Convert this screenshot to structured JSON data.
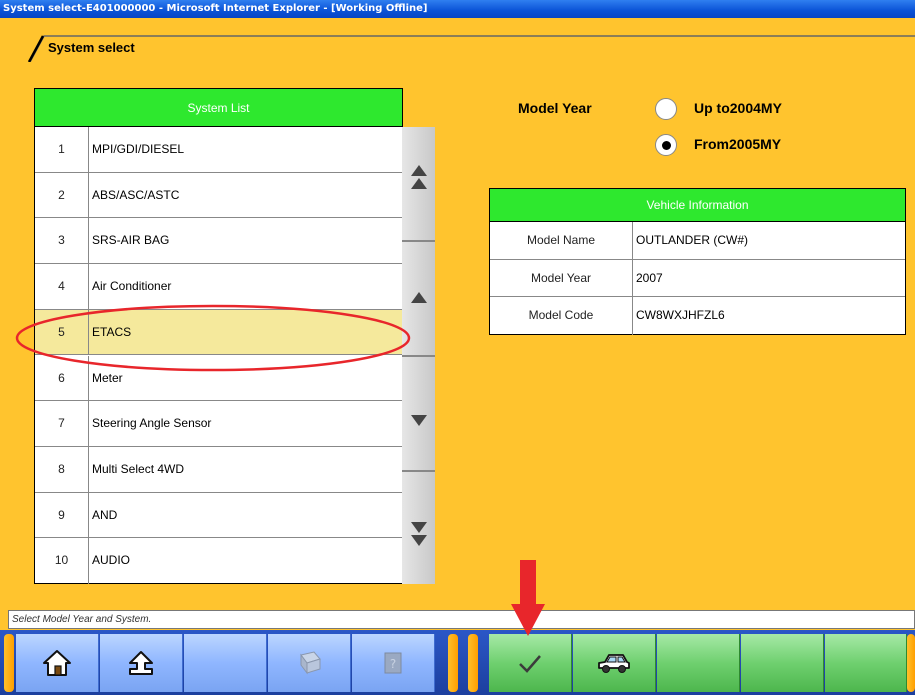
{
  "window": {
    "title": "System select-E401000000 - Microsoft Internet Explorer - [Working Offline]"
  },
  "header": {
    "title": "System select"
  },
  "system_list": {
    "header": "System List",
    "rows": [
      {
        "num": "1",
        "name": "MPI/GDI/DIESEL"
      },
      {
        "num": "2",
        "name": "ABS/ASC/ASTC"
      },
      {
        "num": "3",
        "name": "SRS-AIR BAG"
      },
      {
        "num": "4",
        "name": "Air Conditioner"
      },
      {
        "num": "5",
        "name": "ETACS"
      },
      {
        "num": "6",
        "name": "Meter"
      },
      {
        "num": "7",
        "name": "Steering Angle Sensor"
      },
      {
        "num": "8",
        "name": "Multi Select 4WD"
      },
      {
        "num": "9",
        "name": "AND"
      },
      {
        "num": "10",
        "name": "AUDIO"
      }
    ],
    "selected": "5"
  },
  "model_year": {
    "label": "Model Year",
    "options": [
      {
        "label": "Up to2004MY",
        "checked": false
      },
      {
        "label": "From2005MY",
        "checked": true
      }
    ]
  },
  "vehicle_info": {
    "header": "Vehicle Information",
    "rows": [
      {
        "key": "Model Name",
        "value": "OUTLANDER (CW#)"
      },
      {
        "key": "Model Year",
        "value": "2007"
      },
      {
        "key": "Model Code",
        "value": "CW8WXJHFZL6"
      }
    ]
  },
  "status": {
    "text": "Select Model Year and System."
  },
  "toolbar": {
    "left_buttons": [
      "home-icon",
      "back-icon",
      "blank",
      "print-icon",
      "help-icon"
    ],
    "right_buttons": [
      "check-icon",
      "car-icon",
      "blank",
      "blank",
      "blank"
    ]
  },
  "colors": {
    "background": "#FFC42E",
    "table_header": "#2EE82E",
    "selected_row": "#F5E99C",
    "annotation": "#E8262B"
  }
}
